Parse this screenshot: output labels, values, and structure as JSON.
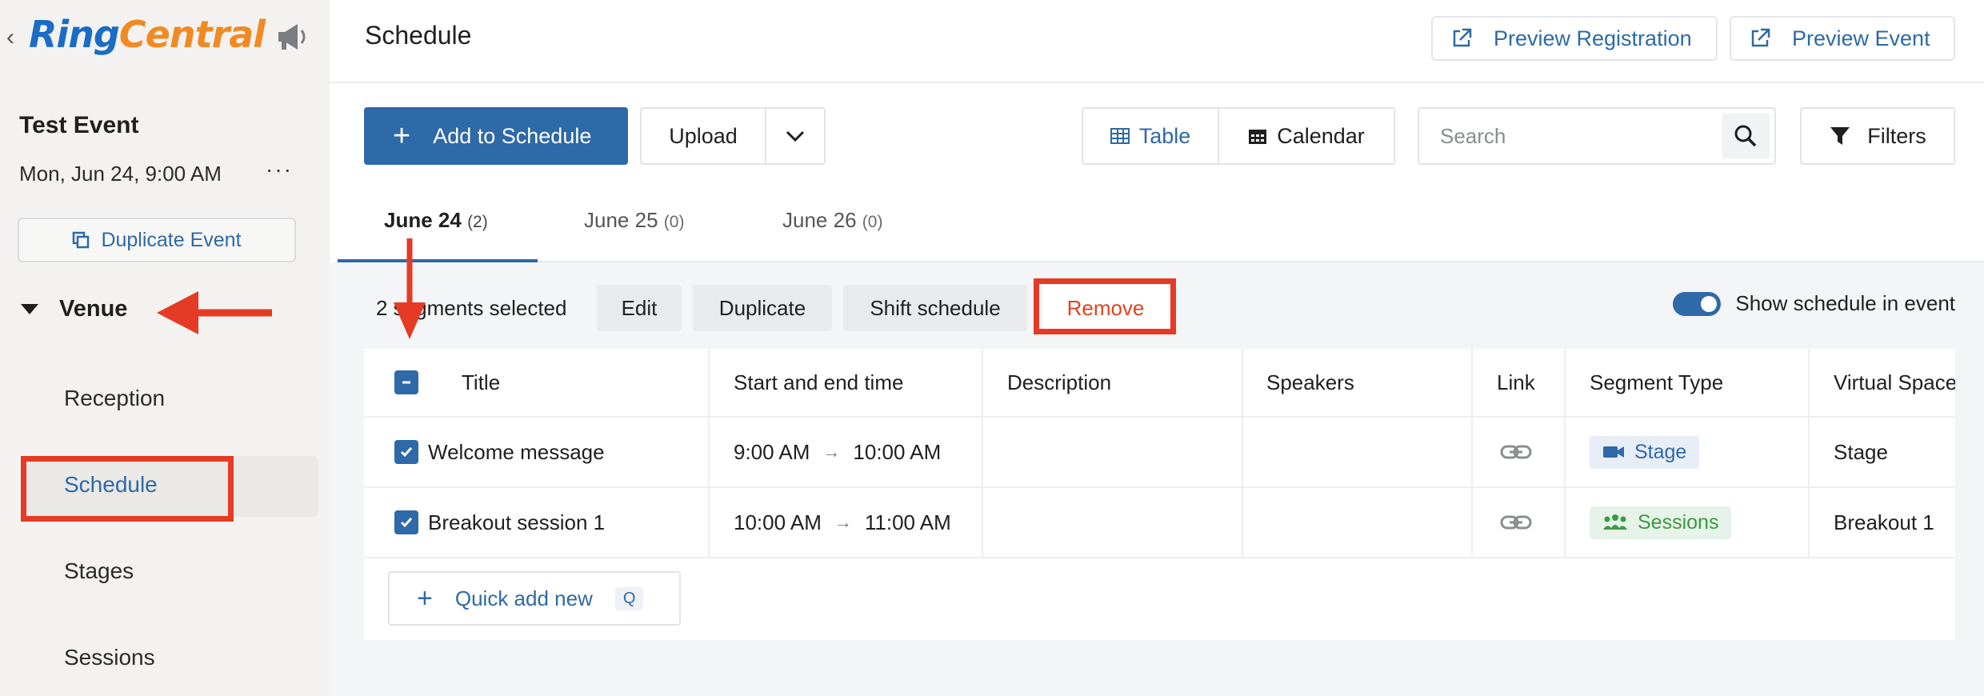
{
  "sidebar": {
    "back_glyph": "‹",
    "logo_ring": "Ring",
    "logo_central": "Central",
    "event_name": "Test Event",
    "event_date": "Mon, Jun 24, 9:00 AM",
    "more_glyph": "···",
    "duplicate_event_label": "Duplicate Event",
    "venue_label": "Venue",
    "nav_items": [
      {
        "label": "Reception"
      },
      {
        "label": "Schedule"
      },
      {
        "label": "Stages"
      },
      {
        "label": "Sessions"
      }
    ],
    "active_item": "Schedule"
  },
  "header": {
    "title": "Schedule",
    "preview_registration_label": "Preview Registration",
    "preview_event_label": "Preview Event"
  },
  "toolbar": {
    "add_label": "Add to Schedule",
    "upload_label": "Upload",
    "view_table_label": "Table",
    "view_calendar_label": "Calendar",
    "active_view": "Table",
    "search_placeholder": "Search",
    "filters_label": "Filters"
  },
  "tabs": [
    {
      "label": "June 24",
      "count": "(2)"
    },
    {
      "label": "June 25",
      "count": "(0)"
    },
    {
      "label": "June 26",
      "count": "(0)"
    }
  ],
  "selection": {
    "text": "2 segments selected",
    "edit_label": "Edit",
    "duplicate_label": "Duplicate",
    "shift_label": "Shift schedule",
    "remove_label": "Remove",
    "show_schedule_label": "Show schedule in event",
    "show_schedule_on": true
  },
  "table": {
    "columns": [
      "Title",
      "Start and end time",
      "Description",
      "Speakers",
      "Link",
      "Segment Type",
      "Virtual Space"
    ],
    "rows": [
      {
        "title": "Welcome message",
        "start": "9:00 AM",
        "end": "10:00 AM",
        "description": "",
        "speakers": "",
        "segment_type": "Stage",
        "virtual_space": "Stage"
      },
      {
        "title": "Breakout session 1",
        "start": "10:00 AM",
        "end": "11:00 AM",
        "description": "",
        "speakers": "",
        "segment_type": "Sessions",
        "virtual_space": "Breakout 1"
      }
    ],
    "arrow_glyph": "→",
    "quick_add_label": "Quick add new",
    "quick_add_shortcut": "Q"
  },
  "colors": {
    "primary": "#2e69a8",
    "annotation_red": "#e53a24",
    "stage_badge_bg": "#e8eef6",
    "sessions_badge": "#3a9a45"
  }
}
